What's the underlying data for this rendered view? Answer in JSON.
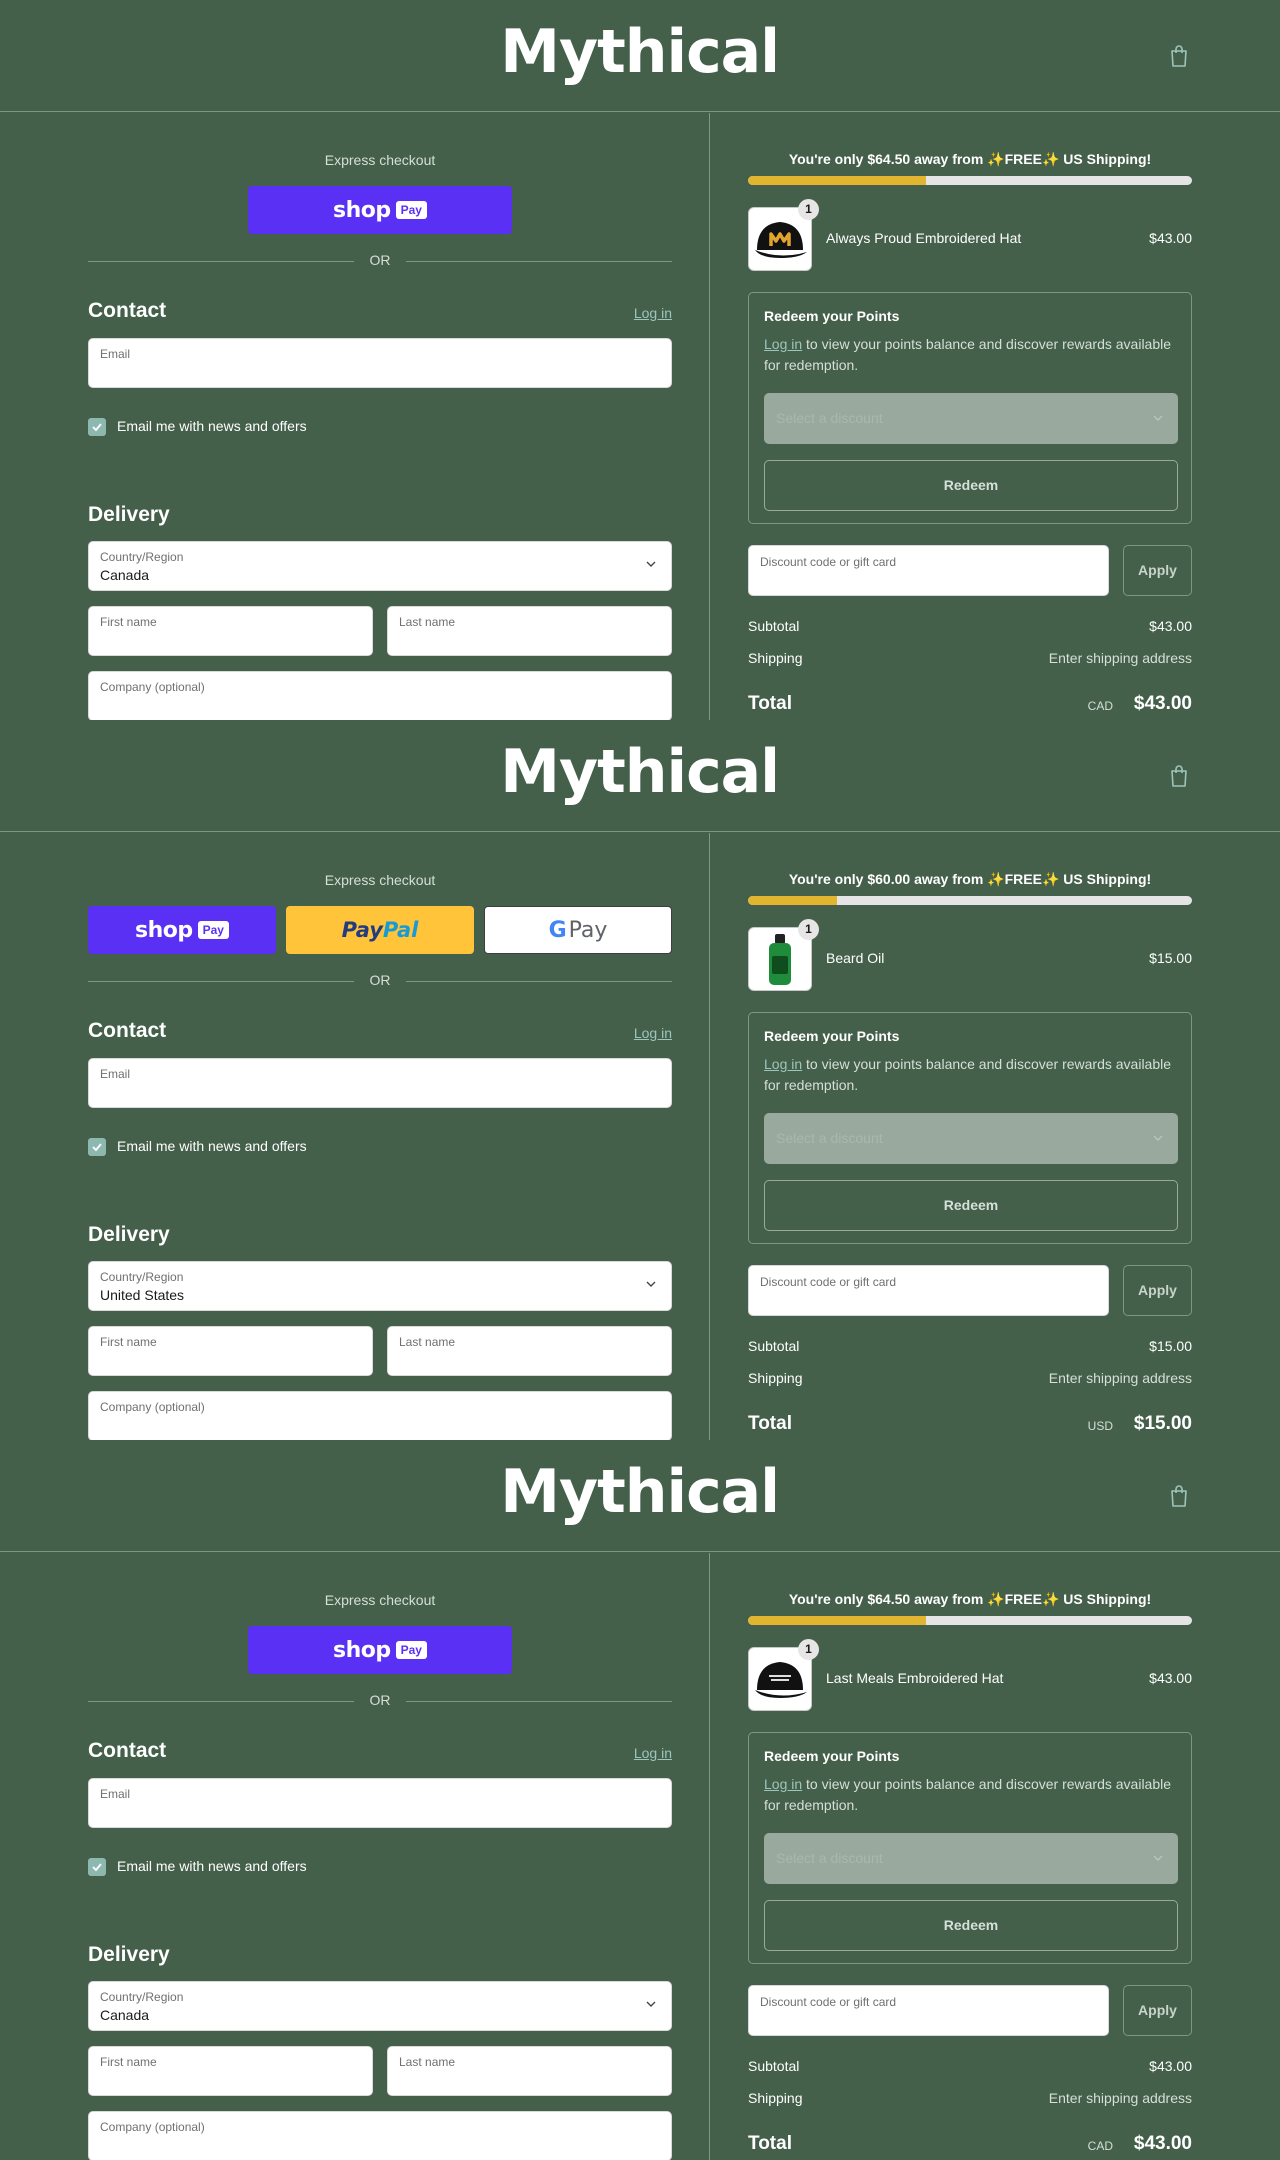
{
  "colors": {
    "background": "#445f4a",
    "shop_pay": "#5a31f4",
    "paypal": "#ffc439",
    "progress_fill": "#e1b52f",
    "link": "#9ec5bd"
  },
  "common": {
    "logo_text": "Mythical",
    "cart_icon": "shopping-bag-icon",
    "express_label": "Express checkout",
    "shop_word": "shop",
    "shop_pay_badge": "Pay",
    "paypal_pay": "Pay",
    "paypal_pal": "Pal",
    "gpay_g": "G",
    "gpay_word": "Pay",
    "or_label": "OR",
    "contact_title": "Contact",
    "login_label": "Log in",
    "email_label": "Email",
    "newsletter_label": "Email me with news and offers",
    "delivery_title": "Delivery",
    "country_label": "Country/Region",
    "first_name_label": "First name",
    "last_name_label": "Last name",
    "company_label": "Company (optional)",
    "redeem_title": "Redeem your Points",
    "redeem_link": "Log in",
    "redeem_text": " to view your points balance and discover rewards available for redemption.",
    "redeem_placeholder": "Select a discount",
    "redeem_button": "Redeem",
    "discount_label": "Discount code or gift card",
    "apply_button": "Apply",
    "subtotal_label": "Subtotal",
    "shipping_label": "Shipping",
    "shipping_value": "Enter shipping address",
    "total_label": "Total"
  },
  "panels": [
    {
      "shipping_message": "You're only $64.50 away from ✨FREE✨ US Shipping!",
      "progress_fraction": 0.4,
      "express_methods": [
        "shop-pay"
      ],
      "product": {
        "name": "Always Proud Embroidered Hat",
        "price": "$43.00",
        "quantity": "1",
        "image": "black-cap-orange-m-logo"
      },
      "country": "Canada",
      "subtotal": "$43.00",
      "currency": "CAD",
      "total": "$43.00"
    },
    {
      "shipping_message": "You're only $60.00 away from ✨FREE✨ US Shipping!",
      "progress_fraction": 0.2,
      "express_methods": [
        "shop-pay",
        "paypal",
        "google-pay"
      ],
      "product": {
        "name": "Beard Oil",
        "price": "$15.00",
        "quantity": "1",
        "image": "green-dropper-bottle"
      },
      "country": "United States",
      "subtotal": "$15.00",
      "currency": "USD",
      "total": "$15.00"
    },
    {
      "shipping_message": "You're only $64.50 away from ✨FREE✨ US Shipping!",
      "progress_fraction": 0.4,
      "express_methods": [
        "shop-pay"
      ],
      "product": {
        "name": "Last Meals Embroidered Hat",
        "price": "$43.00",
        "quantity": "1",
        "image": "black-cap-white-text"
      },
      "country": "Canada",
      "subtotal": "$43.00",
      "currency": "CAD",
      "total": "$43.00"
    }
  ]
}
